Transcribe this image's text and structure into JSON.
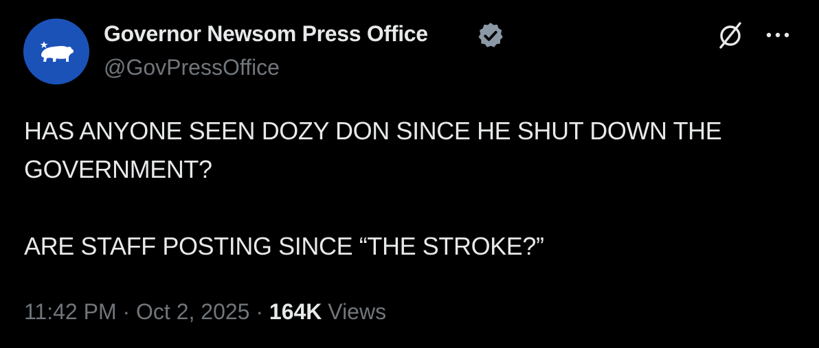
{
  "author": {
    "display_name": "Governor Newsom Press Office",
    "handle": "@GovPressOffice",
    "verified": true,
    "avatar_color": "#1b52b8"
  },
  "tweet": {
    "line1": "HAS ANYONE SEEN DOZY DON SINCE HE SHUT DOWN THE",
    "line2": "GOVERNMENT?",
    "line3": "ARE STAFF POSTING SINCE “THE STROKE?”"
  },
  "meta": {
    "time": "11:42 PM",
    "separator": "·",
    "date": "Oct 2, 2025",
    "views_count": "164K",
    "views_label": "Views"
  },
  "icons": {
    "avatar": "california-bear-icon",
    "verified": "verified-badge-icon",
    "grok": "grok-icon",
    "more": "more-icon"
  },
  "colors": {
    "background": "#000000",
    "text_primary": "#e7e9ea",
    "text_secondary": "#71767b",
    "verified_badge": "#8b98a5"
  }
}
